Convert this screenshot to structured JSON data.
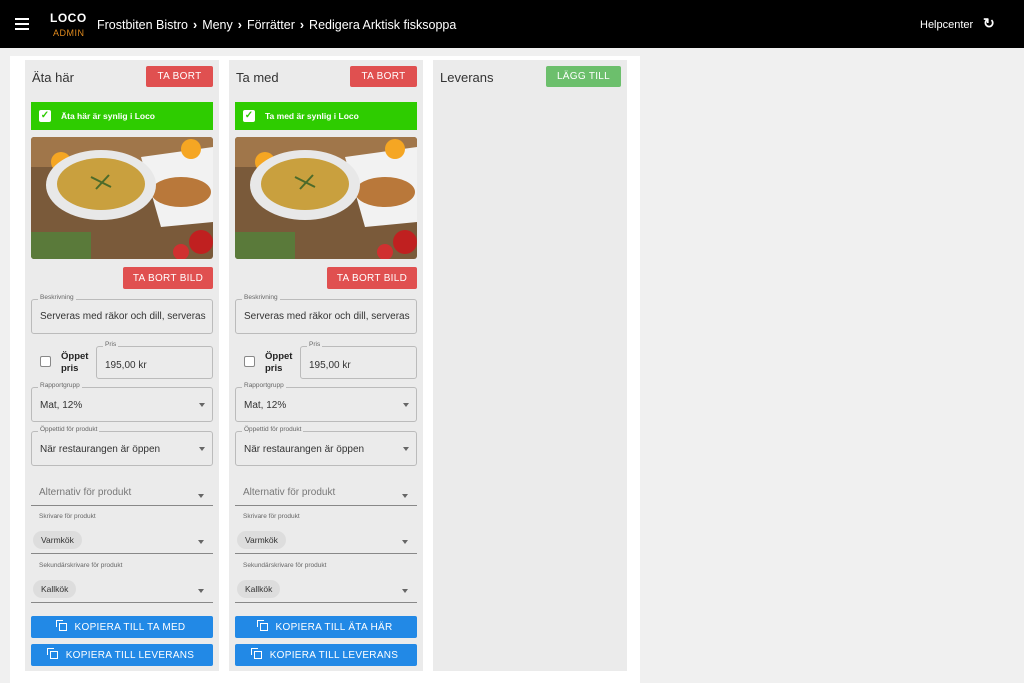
{
  "header": {
    "logo": "LOCO",
    "logo_sub": "ADMIN",
    "breadcrumb": [
      "Frostbiten Bistro",
      "Meny",
      "Förrätter",
      "Redigera Arktisk fisksoppa"
    ],
    "help": "Helpcenter",
    "icons": {
      "menu": "hamburger-icon",
      "refresh": "refresh-icon"
    }
  },
  "columns": [
    {
      "title": "Äta här",
      "action_label": "TA BORT",
      "visible_label": "Äta här är synlig i Loco",
      "remove_image_label": "TA BORT BILD",
      "description_label": "Beskrivning",
      "description_value": "Serveras med räkor och dill, serveras",
      "open_price_label": "Öppet pris",
      "price_label": "Pris",
      "price_value": "195,00 kr",
      "report_group_label": "Rapportgrupp",
      "report_group_value": "Mat, 12%",
      "open_time_label": "Öppettid för produkt",
      "open_time_value": "När restaurangen är öppen",
      "options_placeholder": "Alternativ för produkt",
      "printer_label": "Skrivare för produkt",
      "printer_value": "Varmkök",
      "second_printer_label": "Sekundärskrivare för produkt",
      "second_printer_value": "Kallkök",
      "copy_1": "KOPIERA TILL TA MED",
      "copy_2": "KOPIERA TILL LEVERANS"
    },
    {
      "title": "Ta med",
      "action_label": "TA BORT",
      "visible_label": "Ta med är synlig i Loco",
      "remove_image_label": "TA BORT BILD",
      "description_label": "Beskrivning",
      "description_value": "Serveras med räkor och dill, serveras",
      "open_price_label": "Öppet pris",
      "price_label": "Pris",
      "price_value": "195,00 kr",
      "report_group_label": "Rapportgrupp",
      "report_group_value": "Mat, 12%",
      "open_time_label": "Öppettid för produkt",
      "open_time_value": "När restaurangen är öppen",
      "options_placeholder": "Alternativ för produkt",
      "printer_label": "Skrivare för produkt",
      "printer_value": "Varmkök",
      "second_printer_label": "Sekundärskrivare för produkt",
      "second_printer_value": "Kallkök",
      "copy_1": "KOPIERA TILL ÄTA HÄR",
      "copy_2": "KOPIERA TILL LEVERANS"
    },
    {
      "title": "Leverans",
      "action_label": "LÄGG TILL"
    }
  ],
  "colors": {
    "red": "#e05050",
    "green_button": "#6cbf6c",
    "green_bar": "#2ecc00",
    "blue": "#2289e6"
  }
}
